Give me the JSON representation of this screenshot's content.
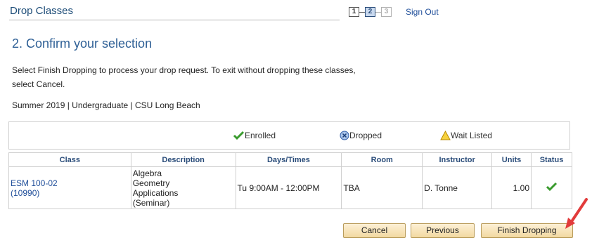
{
  "header": {
    "title": "Drop Classes",
    "steps": [
      "1",
      "2",
      "3"
    ],
    "sign_out": "Sign Out"
  },
  "main": {
    "heading": "2.  Confirm your selection",
    "instructions_line1": "Select Finish Dropping to process your drop request. To exit without dropping these classes,",
    "instructions_line2": "select Cancel.",
    "term": "Summer 2019 | Undergraduate | CSU Long Beach"
  },
  "legend": {
    "enrolled": "Enrolled",
    "dropped": "Dropped",
    "wait_listed": "Wait Listed"
  },
  "table": {
    "columns": [
      "Class",
      "Description",
      "Days/Times",
      "Room",
      "Instructor",
      "Units",
      "Status"
    ],
    "rows": [
      {
        "class_code": "ESM 100-02",
        "class_number": "(10990)",
        "description": [
          "Algebra",
          "Geometry",
          "Applications",
          "(Seminar)"
        ],
        "days_times": "Tu 9:00AM - 12:00PM",
        "room": "TBA",
        "instructor": "D. Tonne",
        "units": "1.00",
        "status_icon": "enrolled-check-icon"
      }
    ]
  },
  "buttons": {
    "cancel": "Cancel",
    "previous": "Previous",
    "finish": "Finish Dropping"
  },
  "colors": {
    "link": "#1f4e9a",
    "heading": "#2f6096",
    "check": "#3a9b2e",
    "arrow": "#e23b3b"
  }
}
